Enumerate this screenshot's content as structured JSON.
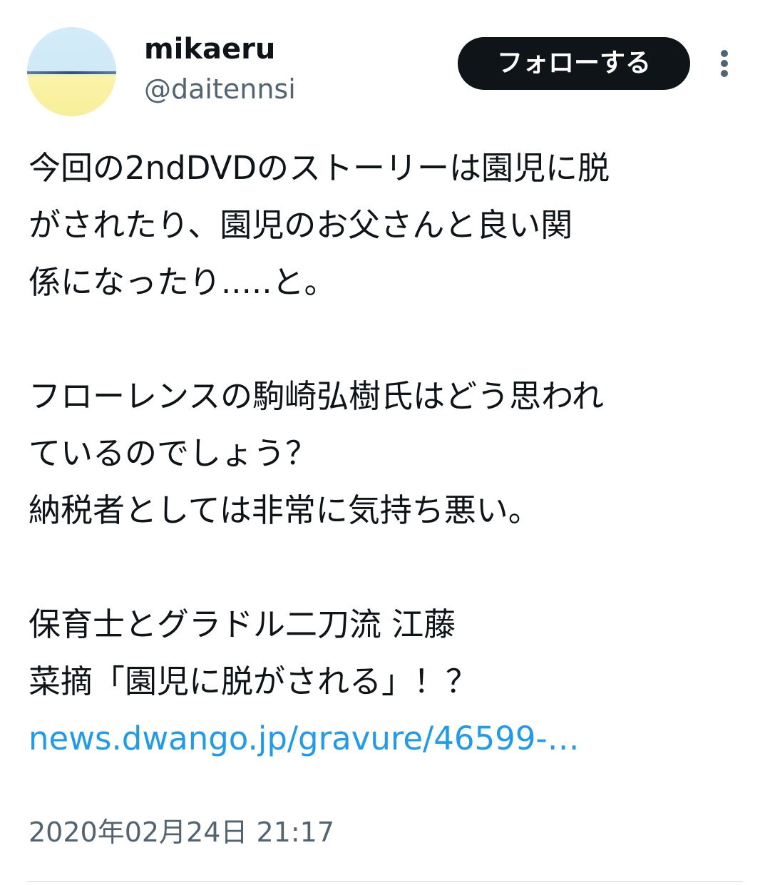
{
  "author": {
    "display_name": "mikaeru",
    "handle": "@daitennsi",
    "avatar_icon": "profile-avatar-sky-horizon"
  },
  "follow_button_label": "フォローする",
  "more_icon": "more-vertical-icon",
  "tweet": {
    "paragraph1": [
      "今回の2ndDVDのストーリーは園児に脱",
      "がされたり、園児のお父さんと良い関",
      "係になったり.....と。"
    ],
    "paragraph2": [
      "フローレンスの駒崎弘樹氏はどう思われ",
      "ているのでしょう？",
      "納税者としては非常に気持ち悪い。"
    ],
    "paragraph3": [
      "保育士とグラドル二刀流 江藤",
      "菜摘「園児に脱がされる」！？"
    ],
    "link": "news.dwango.jp/gravure/46599-…"
  },
  "timestamp": "2020年02月24日 21:17",
  "colors": {
    "text": "#0f1419",
    "secondary": "#536471",
    "link": "#1d9bf0",
    "button_bg": "#0f1419"
  }
}
